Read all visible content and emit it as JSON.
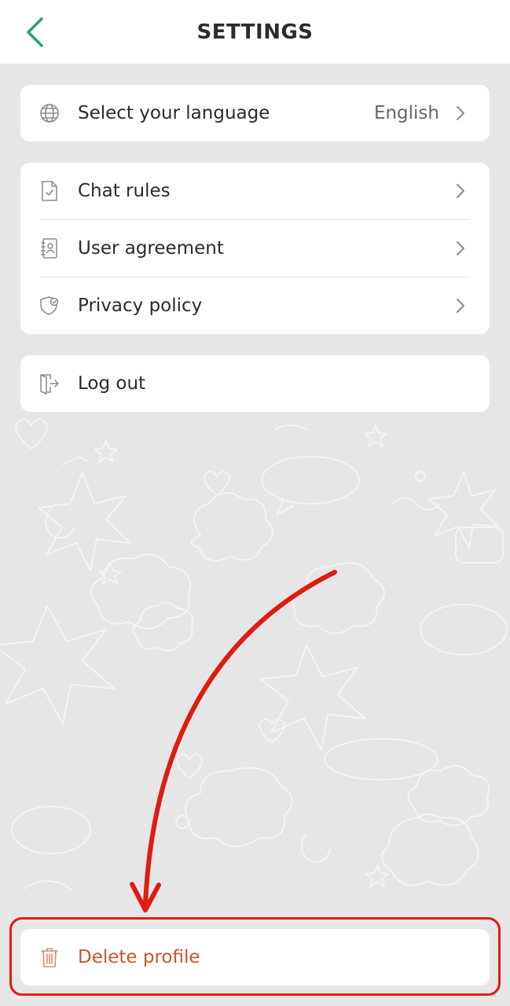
{
  "header": {
    "title": "SETTINGS",
    "back_icon": "chevron-left-icon",
    "accent_color": "#2e9d77"
  },
  "language_card": {
    "label": "Select your language",
    "value": "English",
    "icon": "globe-icon"
  },
  "info_card": {
    "items": [
      {
        "label": "Chat rules",
        "icon": "document-check-icon"
      },
      {
        "label": "User agreement",
        "icon": "contact-book-icon"
      },
      {
        "label": "Privacy policy",
        "icon": "shield-check-icon"
      }
    ]
  },
  "logout_card": {
    "label": "Log out",
    "icon": "door-exit-icon"
  },
  "delete_card": {
    "label": "Delete profile",
    "icon": "trash-icon",
    "color": "#c8552f"
  },
  "annotation": {
    "color": "#e01b12"
  }
}
